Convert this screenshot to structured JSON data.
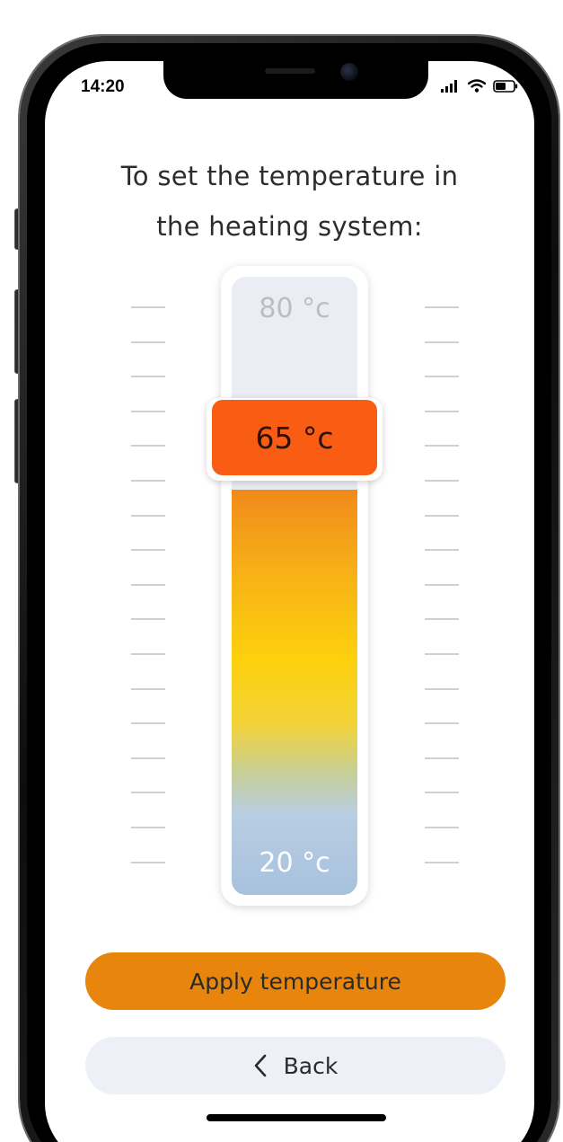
{
  "status_bar": {
    "time": "14:20",
    "icons": [
      "signal-icon",
      "wifi-icon",
      "battery-icon"
    ]
  },
  "heading": {
    "line1": "To set the temperature in",
    "line2": "the heating system:"
  },
  "thermostat": {
    "max_label": "80 °c",
    "min_label": "20 °c",
    "current_label": "65 °c",
    "min_value": 20,
    "max_value": 80,
    "current_value": 65,
    "tick_count": 17,
    "colors": {
      "handle": "#f95d13",
      "fill_top": "#f08a1b",
      "fill_mid": "#fdd10c",
      "fill_bottom": "#a7c2de",
      "track": "#eaeef4"
    }
  },
  "actions": {
    "apply_label": "Apply temperature",
    "back_label": "Back",
    "back_icon": "chevron-left-icon",
    "apply_color": "#e8850c",
    "back_color": "#edf1f7"
  }
}
